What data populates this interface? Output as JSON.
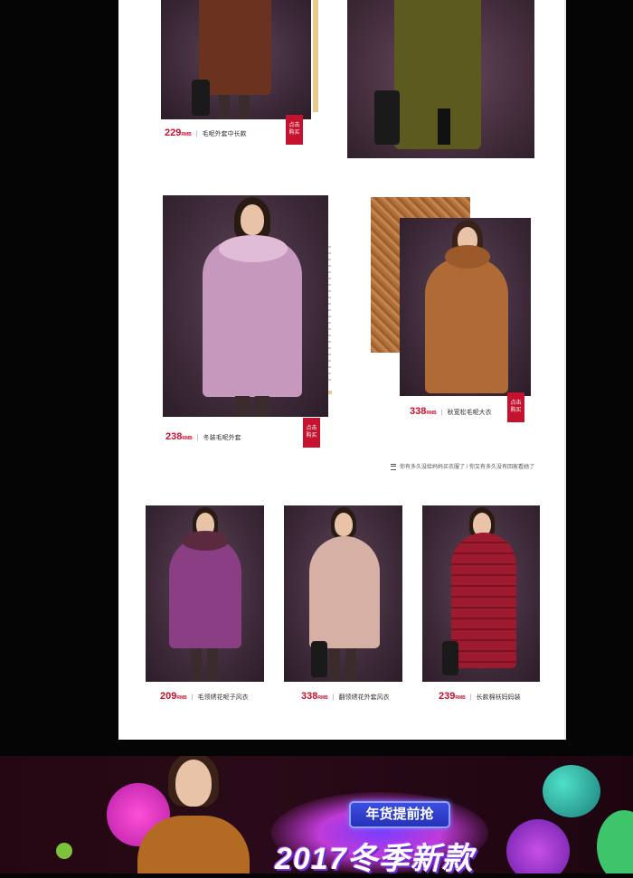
{
  "products": [
    {
      "price": "229",
      "unit": "RMB",
      "name": "毛呢外套中长款",
      "buy_label_1": "点击",
      "buy_label_2": "购买"
    },
    {
      "price": "238",
      "unit": "RMB",
      "name": "冬装毛呢外套",
      "buy_label_1": "点击",
      "buy_label_2": "购买"
    },
    {
      "price": "338",
      "unit": "RMB",
      "name": "秋宽松毛呢大衣",
      "buy_label_1": "点击",
      "buy_label_2": "购买"
    },
    {
      "price": "209",
      "unit": "RMB",
      "name": "毛领绣花呢子风衣"
    },
    {
      "price": "338",
      "unit": "RMB",
      "name": "翻领绣花外套风衣"
    },
    {
      "price": "239",
      "unit": "RMB",
      "name": "长款棉袄妈妈装"
    }
  ],
  "separator": "|",
  "note": "你有多久没给妈妈买衣服了 / 你又有多久没有回家看她了",
  "banner": {
    "tag": "年货提前抢",
    "title": "2017冬季新款"
  },
  "colors": {
    "accent_red": "#c4122f",
    "banner_tag_blue": "#2f3dd0"
  }
}
